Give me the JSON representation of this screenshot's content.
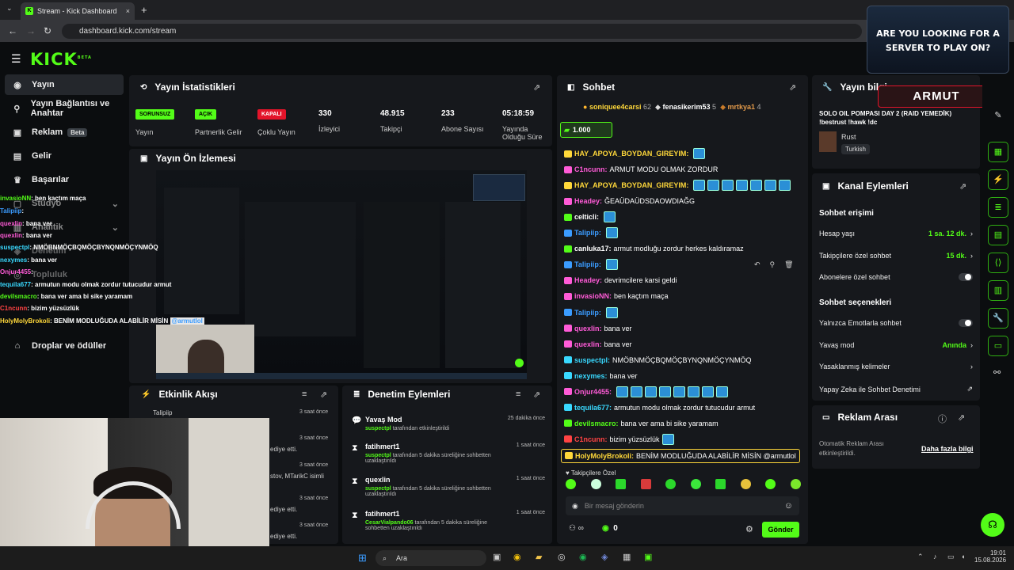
{
  "browser": {
    "tab_title": "Stream - Kick Dashboard",
    "url": "dashboard.kick.com/stream",
    "tab_close": "×",
    "new_tab": "+"
  },
  "brand": {
    "logo": "KICK",
    "logo_sup": "BETA",
    "accent": "#53fc18"
  },
  "sidebar": {
    "items": [
      {
        "label": "Yayın",
        "icon": "broadcast-icon"
      },
      {
        "label": "Yayın Bağlantısı ve Anahtar",
        "icon": "link-icon"
      },
      {
        "label": "Reklam",
        "icon": "ad-icon",
        "badge": "Beta"
      },
      {
        "label": "Gelir",
        "icon": "revenue-icon"
      },
      {
        "label": "Başarılar",
        "icon": "trophy-icon"
      },
      {
        "label": "Stüdyo",
        "icon": "studio-icon"
      },
      {
        "label": "Analitik",
        "icon": "analytics-icon"
      },
      {
        "label": "Denetim",
        "icon": "shield-icon"
      },
      {
        "label": "Topluluk",
        "icon": "community-icon"
      },
      {
        "label": "Droplar ve ödüller",
        "icon": "gift-icon"
      }
    ]
  },
  "stats": {
    "title": "Yayın İstatistikleri",
    "items": [
      {
        "pill": "SORUNSUZ",
        "label": "Yayın"
      },
      {
        "pill": "AÇIK",
        "label": "Partnerlik Gelir"
      },
      {
        "pill": "KAPALI",
        "label": "Çoklu Yayın"
      },
      {
        "value": "330",
        "label": "İzleyici"
      },
      {
        "value": "48.915",
        "label": "Takipçi"
      },
      {
        "value": "233",
        "label": "Abone Sayısı"
      },
      {
        "value": "05:18:59",
        "label": "Yayında Olduğu Süre"
      }
    ]
  },
  "preview": {
    "title": "Yayın Ön İzlemesi",
    "overlay_banner": "ARE YOU LOOKING FOR A SERVER TO PLAY ON?",
    "overlay_tag": "ARMUT"
  },
  "overlay_chat": [
    {
      "user": "invasioNN",
      "text": ": ben kaçtım maça",
      "color": "#53fc18"
    },
    {
      "user": "Talipiip",
      "text": ":",
      "color": "#3b9cff"
    },
    {
      "user": "quexlin",
      "text": ": bana ver",
      "color": "#ff5bd7"
    },
    {
      "user": "quexlin",
      "text": ": bana ver",
      "color": "#ff5bd7"
    },
    {
      "user": "suspectpl",
      "text": ": NMÖBNMÖÇBQMÖÇBYNQNMÖÇYNMÖQ",
      "color": "#39d9ff"
    },
    {
      "user": "nexymes",
      "text": ": bana ver",
      "color": "#39d9ff"
    },
    {
      "user": "Onjur4455",
      "text": ":",
      "color": "#ff5bd7"
    },
    {
      "user": "tequila677",
      "text": ": armutun modu olmak zordur tutucudur armut",
      "color": "#39d9ff"
    },
    {
      "user": "devilsmacro",
      "text": ": bana ver ama bi sike yaramam",
      "color": "#53fc18"
    },
    {
      "user": "C1ncunn",
      "text": ": bizim yüzsüzlük",
      "color": "#ff4343"
    },
    {
      "user": "HolyMolyBrokoli",
      "text": ": BENİM MODLUĞUDA ALABİLİR MİSİN",
      "mention": "@armutlol",
      "color": "#ffd83a"
    }
  ],
  "activity": {
    "title": "Etkinlik Akışı",
    "items": [
      {
        "user": "Talipiip",
        "time": "3 saat önce"
      },
      {
        "user": "",
        "time": "3 saat önce",
        "text": "ediye etti."
      },
      {
        "user": "",
        "time": "3 saat önce",
        "text": "stov, MTarikC isimli"
      },
      {
        "user": "",
        "time": "3 saat önce",
        "text": "ediye etti."
      },
      {
        "user": "",
        "time": "3 saat önce",
        "text": "ediye etti."
      }
    ]
  },
  "moderation": {
    "title": "Denetim Eylemleri",
    "items": [
      {
        "title": "Yavaş Mod",
        "actor": "suspectpl",
        "desc": "tarafından etkinleştirildi",
        "time": "25 dakika önce"
      },
      {
        "title": "fatihmert1",
        "actor": "suspectpl",
        "desc": "tarafından 5 dakika süreliğine sohbetten uzaklaştırıldı",
        "time": "1 saat önce"
      },
      {
        "title": "quexlin",
        "actor": "suspectpl",
        "desc": "tarafından 5 dakika süreliğine sohbetten uzaklaştırıldı",
        "time": "1 saat önce"
      },
      {
        "title": "fatihmert1",
        "actor": "CesarVialpando06",
        "desc": "tarafından 5 dakika süreliğine sohbetten uzaklaştırıldı",
        "time": "1 saat önce"
      }
    ]
  },
  "chat": {
    "title": "Sohbet",
    "top_gifters": [
      {
        "name": "soniquee4carsi",
        "count": "62"
      },
      {
        "name": "fenasikerim53",
        "count": "5"
      },
      {
        "name": "mrtkya1",
        "count": "4"
      }
    ],
    "kicks_counter": "1.000",
    "messages": [
      {
        "user": "HAY_APOYA_BOYDAN_GIREYIM:",
        "text": "",
        "color": "#ffd83a",
        "emotes": 1
      },
      {
        "user": "C1ncunn:",
        "text": "ARMUT MODU OLMAK ZORDUR",
        "color": "#ff5bd7",
        "emotes": 0
      },
      {
        "user": "HAY_APOYA_BOYDAN_GIREYIM:",
        "text": "",
        "color": "#ffd83a",
        "emotes": 7
      },
      {
        "user": "Headey:",
        "text": "ĞEAÜDAÜDSDAOWDIAĞG",
        "color": "#ff5bd7",
        "emotes": 0
      },
      {
        "user": "celticli:",
        "text": "",
        "color": "#fff",
        "emotes": 1
      },
      {
        "user": "Talipiip:",
        "text": "",
        "color": "#3b9cff",
        "emotes": 1
      },
      {
        "user": "canluka17:",
        "text": "armut modluğu zordur herkes kaldıramaz",
        "color": "#fff",
        "emotes": 0
      },
      {
        "user": "Talipiip:",
        "text": "",
        "color": "#3b9cff",
        "emotes": 1
      },
      {
        "user": "Headey:",
        "text": "devrimcilere karsi geldi",
        "color": "#ff5bd7",
        "emotes": 0
      },
      {
        "user": "invasioNN:",
        "text": "ben kaçtım maça",
        "color": "#ff5bd7",
        "emotes": 0
      },
      {
        "user": "Talipiip:",
        "text": "",
        "color": "#3b9cff",
        "emotes": 1
      },
      {
        "user": "quexlin:",
        "text": "bana ver",
        "color": "#ff5bd7",
        "emotes": 0
      },
      {
        "user": "quexlin:",
        "text": "bana ver",
        "color": "#ff5bd7",
        "emotes": 0
      },
      {
        "user": "suspectpl:",
        "text": "NMÖBNMÖÇBQMÖÇBYNQNMÖÇYNMÖQ",
        "color": "#39d9ff",
        "emotes": 0
      },
      {
        "user": "nexymes:",
        "text": "bana ver",
        "color": "#39d9ff",
        "emotes": 0
      },
      {
        "user": "Onjur4455:",
        "text": "",
        "color": "#ff5bd7",
        "emotes": 8
      },
      {
        "user": "tequila677:",
        "text": "armutun modu olmak zordur tutucudur armut",
        "color": "#39d9ff",
        "emotes": 0
      },
      {
        "user": "devilsmacro:",
        "text": "bana ver ama bi sike yaramam",
        "color": "#53fc18",
        "emotes": 0
      },
      {
        "user": "C1ncunn:",
        "text": "bizim yüzsüzlük",
        "color": "#ff4343",
        "emotes": 1
      },
      {
        "user": "HolyMolyBrokoli:",
        "text": "BENİM MODLUĞUDA ALABİLİR MİSİN @armutlol",
        "color": "#ffd83a",
        "emotes": 0
      }
    ],
    "followers_only_label": "Takipçilere Özel",
    "input_placeholder": "Bir mesaj gönderin",
    "points": "0",
    "send_label": "Gönder"
  },
  "stream_info": {
    "title": "Yayın bilgileri",
    "stream_title": "SOLO OIL POMPASI DAY 2 (RAID YEMEDİK) !bestrust !hawk !dc",
    "category": "Rust",
    "language": "Turkish",
    "overlay_tag": "ARMUT"
  },
  "channel_actions": {
    "title": "Kanal Eylemleri",
    "chat_access": "Sohbet erişimi",
    "rows": [
      {
        "label": "Hesap yaşı",
        "value": "1 sa. 12 dk."
      },
      {
        "label": "Takipçilere özel sohbet",
        "value": "15 dk."
      },
      {
        "label": "Abonelere özel sohbet",
        "value": ""
      }
    ],
    "chat_options": "Sohbet seçenekleri",
    "rows2": [
      {
        "label": "Yalnızca Emotlarla sohbet",
        "value": ""
      },
      {
        "label": "Yavaş mod",
        "value": "Anında"
      },
      {
        "label": "Yasaklanmış kelimeler",
        "value": ""
      },
      {
        "label": "Yapay Zeka ile Sohbet Denetimi",
        "value": ""
      }
    ]
  },
  "ad_break": {
    "title": "Reklam Arası",
    "desc": "Otomatik Reklam Arası etkinleştirildi.",
    "link": "Daha fazla bilgi"
  },
  "taskbar": {
    "search": "Ara",
    "time": "19:01",
    "date": "15.08.2026"
  }
}
